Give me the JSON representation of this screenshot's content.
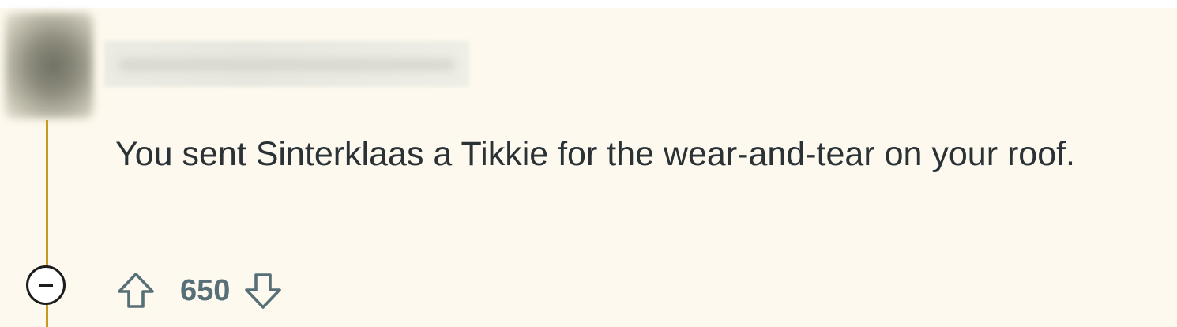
{
  "comment": {
    "author": "",
    "body": "You sent Sinterklaas a Tikkie for the wear-and-tear on your roof.",
    "score": "650"
  },
  "icons": {
    "collapse": "minus-circle-icon",
    "upvote": "arrow-up-icon",
    "downvote": "arrow-down-icon"
  },
  "colors": {
    "background": "#fdf9ee",
    "thread_line": "#c89a1e",
    "text": "#2a3236",
    "vote": "#576f76"
  }
}
